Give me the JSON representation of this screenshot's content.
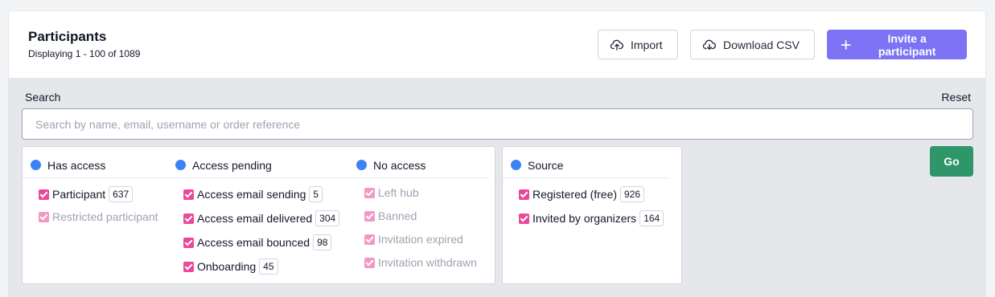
{
  "header": {
    "title": "Participants",
    "subtitle": "Displaying 1 - 100 of 1089",
    "import_label": "Import",
    "download_label": "Download CSV",
    "invite_label": "Invite a participant"
  },
  "search": {
    "label": "Search",
    "reset_label": "Reset",
    "placeholder": "Search by name, email, username or order reference",
    "value": "",
    "go_label": "Go"
  },
  "groups": {
    "has_access": {
      "title": "Has access",
      "options": [
        {
          "label": "Participant",
          "count": "637",
          "checked": true
        },
        {
          "label": "Restricted participant",
          "checked": true
        }
      ]
    },
    "access_pending": {
      "title": "Access pending",
      "options": [
        {
          "label": "Access email sending",
          "count": "5",
          "checked": true
        },
        {
          "label": "Access email delivered",
          "count": "304",
          "checked": true
        },
        {
          "label": "Access email bounced",
          "count": "98",
          "checked": true
        },
        {
          "label": "Onboarding",
          "count": "45",
          "checked": true
        }
      ]
    },
    "no_access": {
      "title": "No access",
      "options": [
        {
          "label": "Left hub",
          "checked": true
        },
        {
          "label": "Banned",
          "checked": true
        },
        {
          "label": "Invitation expired",
          "checked": true
        },
        {
          "label": "Invitation withdrawn",
          "checked": true
        }
      ]
    },
    "source": {
      "title": "Source",
      "options": [
        {
          "label": "Registered (free)",
          "count": "926",
          "checked": true
        },
        {
          "label": "Invited by organizers",
          "count": "164",
          "checked": true
        }
      ]
    }
  },
  "colors": {
    "accent": "#7c74f4",
    "go": "#2e9668",
    "checkbox": "#ec4899",
    "dot": "#3b82f6"
  },
  "icons": {
    "import": "cloud-upload-icon",
    "download": "cloud-download-icon",
    "invite": "plus-icon"
  }
}
